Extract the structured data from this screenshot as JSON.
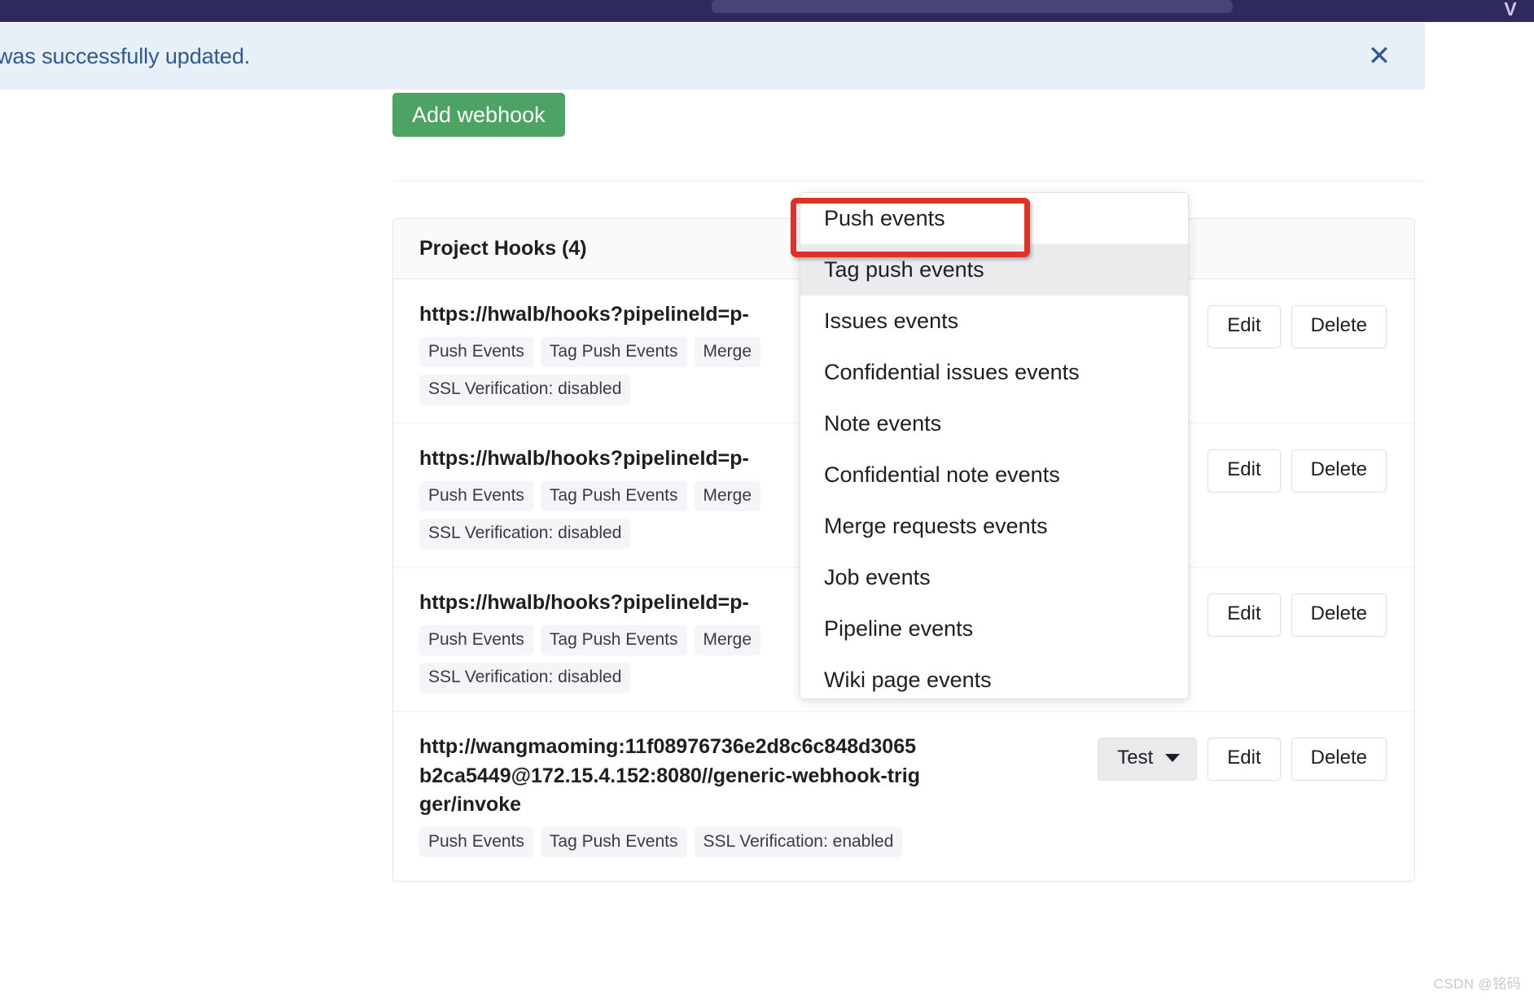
{
  "navbar": {
    "search_placeholder": "",
    "right_glyph": "V"
  },
  "alert": {
    "message": "was successfully updated.",
    "close_label": "✕"
  },
  "toolbar": {
    "add_webhook_label": "Add webhook"
  },
  "hooks_card": {
    "header_title": "Project Hooks (4)",
    "rows": [
      {
        "url": "https://hwalb/hooks?pipelineId=p-",
        "badges": [
          "Push Events",
          "Tag Push Events",
          "Merge",
          "SSL Verification: disabled"
        ],
        "actions": {
          "test": null,
          "edit": "Edit",
          "delete": "Delete"
        }
      },
      {
        "url": "https://hwalb/hooks?pipelineId=p-",
        "badges": [
          "Push Events",
          "Tag Push Events",
          "Merge",
          "SSL Verification: disabled"
        ],
        "actions": {
          "test": null,
          "edit": "Edit",
          "delete": "Delete"
        }
      },
      {
        "url": "https://hwalb/hooks?pipelineId=p-",
        "badges": [
          "Push Events",
          "Tag Push Events",
          "Merge",
          "SSL Verification: disabled"
        ],
        "actions": {
          "test": null,
          "edit": "Edit",
          "delete": "Delete"
        }
      },
      {
        "url": "http://wangmaoming:11f08976736e2d8c6c848d3065b2ca5449@172.15.4.152:8080//generic-webhook-trigger/invoke",
        "badges": [
          "Push Events",
          "Tag Push Events",
          "SSL Verification: enabled"
        ],
        "actions": {
          "test": "Test",
          "edit": "Edit",
          "delete": "Delete"
        }
      }
    ]
  },
  "dropdown": {
    "items": [
      {
        "label": "Push events",
        "active": false
      },
      {
        "label": "Tag push events",
        "active": true
      },
      {
        "label": "Issues events",
        "active": false
      },
      {
        "label": "Confidential issues events",
        "active": false
      },
      {
        "label": "Note events",
        "active": false
      },
      {
        "label": "Confidential note events",
        "active": false
      },
      {
        "label": "Merge requests events",
        "active": false
      },
      {
        "label": "Job events",
        "active": false
      },
      {
        "label": "Pipeline events",
        "active": false
      },
      {
        "label": "Wiki page events",
        "active": false
      }
    ]
  },
  "watermark": "CSDN @铭码",
  "colors": {
    "navbar": "#2e2a5d",
    "alert_bg": "#e7f0f9",
    "alert_text": "#31588f",
    "primary_green": "#4da363",
    "annotation_red": "#e03127"
  }
}
